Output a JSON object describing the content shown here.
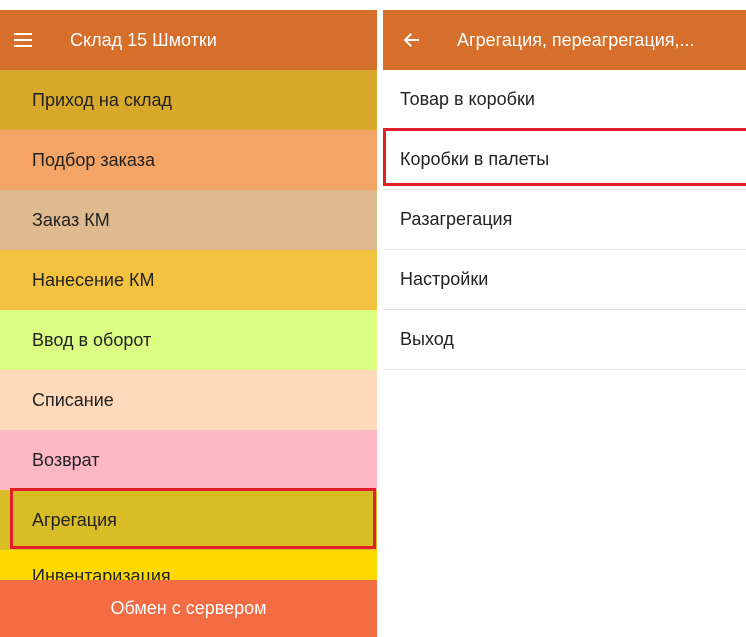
{
  "left_screen": {
    "title": "Склад 15 Шмотки",
    "menu_icon": "hamburger-menu-icon",
    "header_color": "#d56f2b",
    "items": [
      {
        "label": "Приход на склад",
        "color": "#d8a92a"
      },
      {
        "label": "Подбор заказа",
        "color": "#f4a565"
      },
      {
        "label": "Заказ КМ",
        "color": "#deba8e"
      },
      {
        "label": "Нанесение КМ",
        "color": "#f3c240"
      },
      {
        "label": "Ввод в оборот",
        "color": "#dbfe82"
      },
      {
        "label": "Списание",
        "color": "#fed9ba"
      },
      {
        "label": "Возврат",
        "color": "#feb7c5"
      },
      {
        "label": "Агрегация",
        "color": "#d8bd26"
      },
      {
        "label": "Инвентаризация",
        "color": "#ffd800"
      }
    ],
    "selected_item": "Агрегация",
    "highlight_color": "#e3202a",
    "bottom_button": {
      "label": "Обмен с сервером",
      "color": "#f36c43"
    }
  },
  "right_screen": {
    "title": "Агрегация, переагрегация,...",
    "back_icon": "arrow-left-icon",
    "items": [
      {
        "label": "Товар в коробки"
      },
      {
        "label": "Коробки в палеты"
      },
      {
        "label": "Разагрегация"
      },
      {
        "label": "Настройки"
      },
      {
        "label": "Выход"
      }
    ],
    "selected_item": "Коробки в палеты"
  }
}
